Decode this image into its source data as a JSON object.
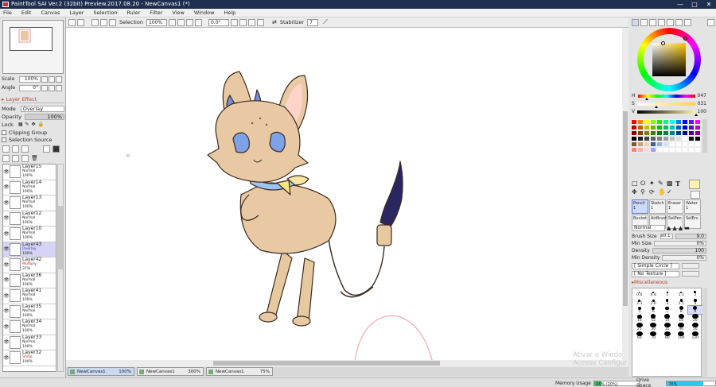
{
  "window": {
    "title": "PaintTool SAI Ver.2 (32bit) Preview.2017.08.20 - NewCanvas1 (*)",
    "controls": [
      "—",
      "□",
      "✕"
    ]
  },
  "menu": [
    "File",
    "Edit",
    "Canvas",
    "Layer",
    "Selection",
    "Ruler",
    "Filter",
    "View",
    "Window",
    "Help"
  ],
  "toolbar": {
    "selection_label": "Selection",
    "zoom": "100%",
    "angle": "0.0°",
    "stabilizer_label": "Stabilizer",
    "stabilizer_value": "7"
  },
  "navigator": {
    "scale_label": "Scale",
    "scale_value": "100%",
    "angle_label": "Angle",
    "angle_value": "0°"
  },
  "layer_effect": {
    "header": "Layer Effect",
    "mode_label": "Mode",
    "mode_value": "Overlay",
    "opacity_label": "Opacity",
    "opacity_value": "100%",
    "lock_label": "Lock",
    "clipping_label": "Clipping Group",
    "selection_source_label": "Selection Source"
  },
  "layers": [
    {
      "name": "Layer15",
      "mode": "Normal",
      "opacity": "100%",
      "selected": false
    },
    {
      "name": "Layer14",
      "mode": "Normal",
      "opacity": "100%",
      "selected": false
    },
    {
      "name": "Layer13",
      "mode": "Normal",
      "opacity": "100%",
      "selected": false
    },
    {
      "name": "Layer12",
      "mode": "Normal",
      "opacity": "100%",
      "selected": false
    },
    {
      "name": "Layer10",
      "mode": "Normal",
      "opacity": "100%",
      "selected": false
    },
    {
      "name": "Layer43",
      "mode": "Overlay",
      "opacity": "100%",
      "selected": true
    },
    {
      "name": "Layer42",
      "mode": "Multiply",
      "opacity": "37%",
      "selected": false
    },
    {
      "name": "Layer36",
      "mode": "Normal",
      "opacity": "100%",
      "selected": false
    },
    {
      "name": "Layer41",
      "mode": "Normal",
      "opacity": "100%",
      "selected": false
    },
    {
      "name": "Layer35",
      "mode": "Normal",
      "opacity": "100%",
      "selected": false
    },
    {
      "name": "Layer34",
      "mode": "Normal",
      "opacity": "100%",
      "selected": false
    },
    {
      "name": "Layer33",
      "mode": "Normal",
      "opacity": "100%",
      "selected": false
    },
    {
      "name": "Layer32",
      "mode": "Shine",
      "opacity": "100%",
      "selected": false
    }
  ],
  "canvas_tabs": [
    {
      "name": "NewCanvas1",
      "zoom": "100%",
      "active": true
    },
    {
      "name": "NewCanvas1",
      "zoom": "300%",
      "active": false
    },
    {
      "name": "NewCanvas1",
      "zoom": "75%",
      "active": false
    }
  ],
  "status": {
    "memory_label": "Memory Usage",
    "memory_value": "16% (20%)",
    "memory_fraction": 0.16,
    "drive_label": "Drive Space",
    "drive_value": "76%",
    "drive_fraction": 0.76
  },
  "watermark": {
    "line1": "Ativar o Windo",
    "line2": "Acesse Configur"
  },
  "color": {
    "current": "#fff2b0",
    "h_label": "H",
    "h_value": "047",
    "s_label": "S",
    "s_value": "031",
    "v_label": "V",
    "v_value": "100"
  },
  "swatches": [
    "#ff0000",
    "#ff7f00",
    "#ffff00",
    "#80ff00",
    "#00ff00",
    "#00ff80",
    "#00ffff",
    "#0080ff",
    "#0000ff",
    "#8000ff",
    "#ff00ff",
    "#c00000",
    "#c06000",
    "#c0c000",
    "#60c000",
    "#00c000",
    "#00c060",
    "#00c0c0",
    "#0060c0",
    "#0000c0",
    "#6000c0",
    "#c000c0",
    "#800000",
    "#804000",
    "#808000",
    "#408000",
    "#008000",
    "#008040",
    "#008080",
    "#004080",
    "#000080",
    "#400080",
    "#800080",
    "#000000",
    "#202020",
    "#404040",
    "#606060",
    "#808080",
    "#a0a0a0",
    "#c0c0c0",
    "#e0e0e0",
    "#ffffff",
    "#111111",
    "#000000",
    "#7a5a3a",
    "#c8a27a",
    "#f2d2b0",
    "#3c5fa8",
    "#8fb4e8",
    "#cfe0f8",
    "#ffffff",
    "#ffffff",
    "#ffffff",
    "#ffffff",
    "#ffffff",
    "#ff8080",
    "#ffb0b0",
    "#ffd8d8",
    "#a0a0ff",
    "#ffffff",
    "#ffffff",
    "#ffffff",
    "#ffffff",
    "#ffffff",
    "#ffffff",
    "#ffffff"
  ],
  "tools": {
    "items": [
      {
        "label": "Pencil",
        "size": "1",
        "active": true
      },
      {
        "label": "Sketch",
        "size": "1",
        "active": false
      },
      {
        "label": "Eraser",
        "size": "1",
        "active": false
      },
      {
        "label": "Water",
        "size": "1",
        "active": false
      },
      {
        "label": "Bucket",
        "size": "",
        "active": false
      },
      {
        "label": "AirBrush",
        "size": "",
        "active": false
      },
      {
        "label": "SelPen",
        "size": "",
        "active": false
      },
      {
        "label": "SelErs",
        "size": "",
        "active": false
      }
    ],
    "blend_mode": "Normal",
    "brush_size_label": "Brush Size",
    "brush_size_mult": "x0.1",
    "brush_size_value": "9.0",
    "min_size_label": "Min Size",
    "min_size_value": "0%",
    "density_label": "Density",
    "density_value": "100",
    "min_density_label": "Min Density",
    "min_density_value": "0%",
    "shape": "[ Simple Circle ]",
    "texture": "[ No Texture ]",
    "misc_label": "Miscellaneous",
    "brush_sizes": [
      "0.6",
      "0.8",
      "1",
      "1.5",
      "2",
      "2.3",
      "2.6",
      "3",
      "3.5",
      "4",
      "5",
      "6",
      "7",
      "8",
      "9",
      "10",
      "12",
      "14",
      "16",
      "20",
      "25",
      "30",
      "35",
      "40",
      "50",
      "60",
      "70",
      "80",
      "100",
      "120",
      "",
      "",
      "",
      "",
      ""
    ],
    "selected_brush": "9"
  }
}
